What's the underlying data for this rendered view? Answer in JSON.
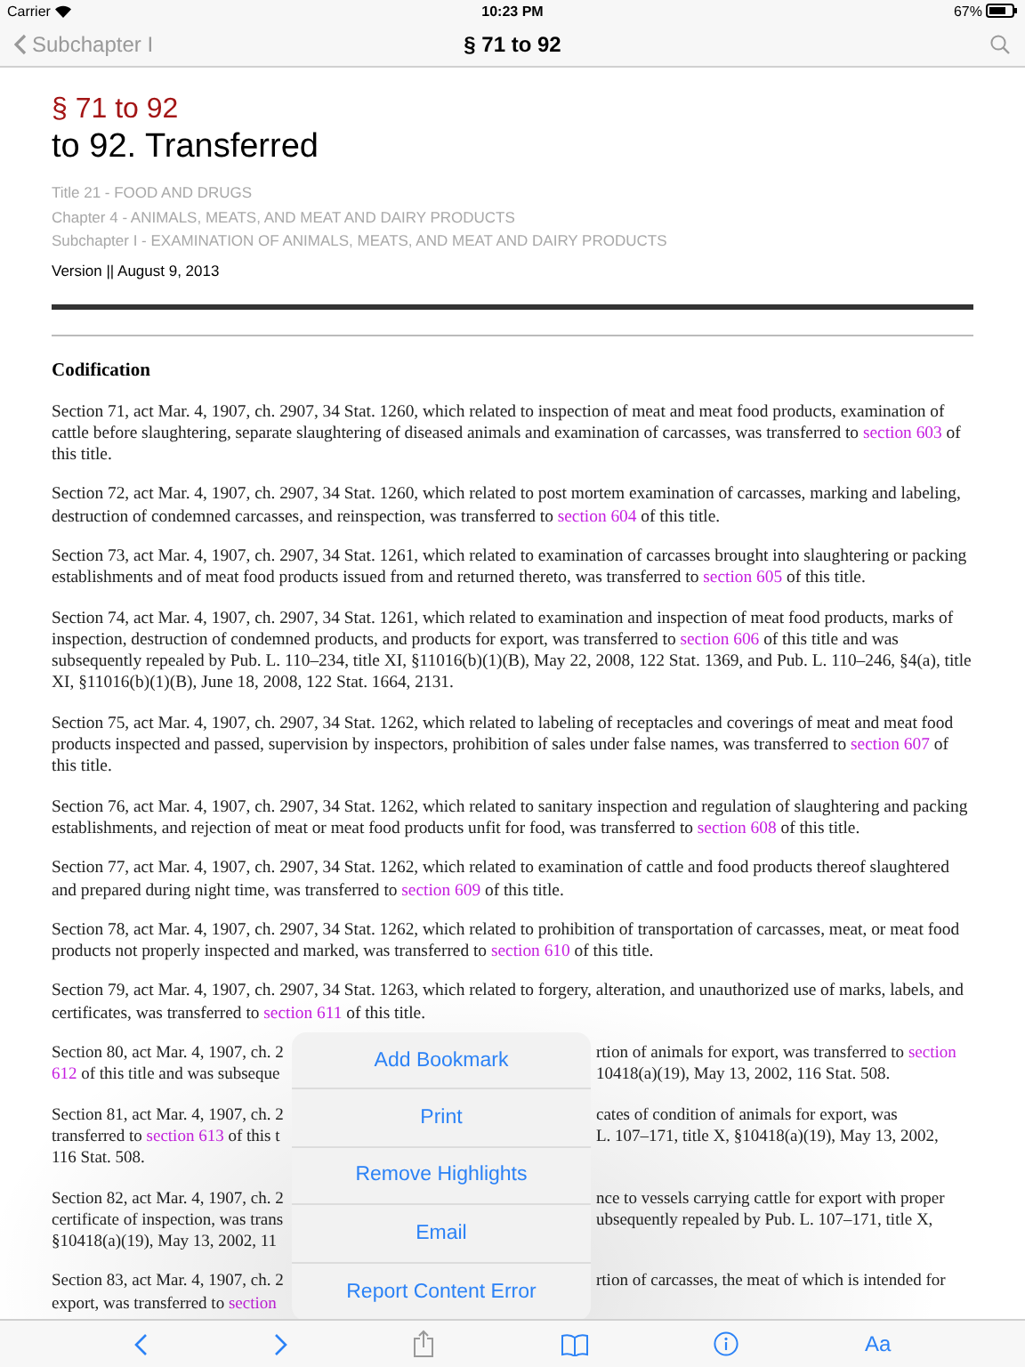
{
  "status_bar": {
    "carrier": "Carrier",
    "time": "10:23 PM",
    "battery": "67%"
  },
  "nav_bar": {
    "back": "Subchapter I",
    "title": "§ 71 to 92"
  },
  "header": {
    "section": "§ 71 to 92",
    "title": "to 92. Transferred",
    "breadcrumbs": [
      "Title 21 - FOOD AND DRUGS",
      "Chapter 4 - ANIMALS, MEATS, AND MEAT AND DAIRY PRODUCTS",
      "Subchapter I - EXAMINATION OF ANIMALS, MEATS, AND MEAT AND DAIRY PRODUCTS"
    ],
    "version": "Version || August 9, 2013"
  },
  "heading": "Codification",
  "paragraphs": [
    {
      "kind": "full",
      "segments": [
        {
          "kind": "text",
          "text": "Section 71, act Mar. 4, 1907, ch. 2907, 34 Stat. 1260, which related to inspection of meat and meat food products, examination of cattle before slaughtering, separate slaughtering of diseased animals and examination of carcasses, was transferred to "
        },
        {
          "kind": "link",
          "text": "section 603"
        },
        {
          "kind": "text",
          "text": " of this title."
        }
      ]
    },
    {
      "kind": "full",
      "segments": [
        {
          "kind": "text",
          "text": "Section 72, act Mar. 4, 1907, ch. 2907, 34 Stat. 1260, which related to post mortem examination of carcasses, marking and labeling, destruction of condemned carcasses, and reinspection, was transferred to "
        },
        {
          "kind": "link",
          "text": "section 604"
        },
        {
          "kind": "text",
          "text": " of this title."
        }
      ]
    },
    {
      "kind": "full",
      "segments": [
        {
          "kind": "text",
          "text": "Section 73, act Mar. 4, 1907, ch. 2907, 34 Stat. 1261, which related to examination of carcasses brought into slaughtering or packing establishments and of meat food products issued from and returned thereto, was transferred to "
        },
        {
          "kind": "link",
          "text": "section 605"
        },
        {
          "kind": "text",
          "text": " of this title."
        }
      ]
    },
    {
      "kind": "full",
      "segments": [
        {
          "kind": "text",
          "text": "Section 74, act Mar. 4, 1907, ch. 2907, 34 Stat. 1261, which related to examination and inspection of meat food products, marks of inspection, destruction of condemned products, and products for export, was transferred to "
        },
        {
          "kind": "link",
          "text": "section 606"
        },
        {
          "kind": "text",
          "text": " of this title and was subsequently repealed by Pub. L. 110–234, title XI, §11016(b)(1)(B), May 22, 2008, 122 Stat. 1369, and Pub. L. 110–246, §4(a), title XI, §11016(b)(1)(B), June 18, 2008, 122 Stat. 1664, 2131."
        }
      ]
    },
    {
      "kind": "full",
      "segments": [
        {
          "kind": "text",
          "text": "Section 75, act Mar. 4, 1907, ch. 2907, 34 Stat. 1262, which related to labeling of receptacles and coverings of meat and meat food products inspected and passed, supervision by inspectors, prohibition of sales under false names, was transferred to "
        },
        {
          "kind": "link",
          "text": "section 607"
        },
        {
          "kind": "text",
          "text": " of this title."
        }
      ]
    },
    {
      "kind": "full",
      "segments": [
        {
          "kind": "text",
          "text": "Section 76, act Mar. 4, 1907, ch. 2907, 34 Stat. 1262, which related to sanitary inspection and regulation of slaughtering and packing establishments, and rejection of meat or meat food products unfit for food, was transferred to "
        },
        {
          "kind": "link",
          "text": "section 608"
        },
        {
          "kind": "text",
          "text": " of this title."
        }
      ]
    },
    {
      "kind": "full",
      "segments": [
        {
          "kind": "text",
          "text": "Section 77, act Mar. 4, 1907, ch. 2907, 34 Stat. 1262, which related to examination of cattle and food products thereof slaughtered and prepared during night time, was transferred to "
        },
        {
          "kind": "link",
          "text": "section 609"
        },
        {
          "kind": "text",
          "text": " of this title."
        }
      ]
    },
    {
      "kind": "full",
      "segments": [
        {
          "kind": "text",
          "text": "Section 78, act Mar. 4, 1907, ch. 2907, 34 Stat. 1262, which related to prohibition of transportation of carcasses, meat, or meat food products not properly inspected and marked, was transferred to "
        },
        {
          "kind": "link",
          "text": "section 610"
        },
        {
          "kind": "text",
          "text": " of this title."
        }
      ]
    },
    {
      "kind": "full",
      "segments": [
        {
          "kind": "text",
          "text": "Section 79, act Mar. 4, 1907, ch. 2907, 34 Stat. 1263, which related to forgery, alteration, and unauthorized use of marks, labels, and certificates, was transferred to "
        },
        {
          "kind": "link",
          "text": "section 611"
        },
        {
          "kind": "text",
          "text": " of this title."
        }
      ]
    },
    {
      "kind": "covered",
      "lines": [
        {
          "left": [
            {
              "kind": "text",
              "text": "Section 80, act Mar. 4, 1907, ch. 2"
            }
          ],
          "right": [
            {
              "kind": "text",
              "text": "rtion of animals for export, was transferred to "
            },
            {
              "kind": "link",
              "text": "section"
            }
          ]
        },
        {
          "left": [
            {
              "kind": "link",
              "text": "612"
            },
            {
              "kind": "text",
              "text": " of this title and was subseque"
            }
          ],
          "right": [
            {
              "kind": "text",
              "text": "10418(a)(19), May 13, 2002, 116 Stat. 508."
            }
          ]
        }
      ]
    },
    {
      "kind": "covered",
      "lines": [
        {
          "left": [
            {
              "kind": "text",
              "text": "Section 81, act Mar. 4, 1907, ch. 2"
            }
          ],
          "right": [
            {
              "kind": "text",
              "text": "cates of condition of animals for export, was"
            }
          ]
        },
        {
          "left": [
            {
              "kind": "text",
              "text": "transferred to "
            },
            {
              "kind": "link",
              "text": "section 613"
            },
            {
              "kind": "text",
              "text": " of this t"
            }
          ],
          "right": [
            {
              "kind": "text",
              "text": "L. 107–171, title X, §10418(a)(19), May 13, 2002,"
            }
          ]
        },
        {
          "left": [
            {
              "kind": "text",
              "text": "116 Stat. 508."
            }
          ]
        }
      ]
    },
    {
      "kind": "covered",
      "lines": [
        {
          "left": [
            {
              "kind": "text",
              "text": "Section 82, act Mar. 4, 1907, ch. 2"
            }
          ],
          "right": [
            {
              "kind": "text",
              "text": "nce to vessels carrying cattle for export with proper"
            }
          ]
        },
        {
          "left": [
            {
              "kind": "text",
              "text": "certificate of inspection, was trans"
            }
          ],
          "right": [
            {
              "kind": "text",
              "text": "ubsequently repealed by Pub. L. 107–171, title X,"
            }
          ]
        },
        {
          "left": [
            {
              "kind": "text",
              "text": "§10418(a)(19), May 13, 2002, 11"
            }
          ]
        }
      ]
    },
    {
      "kind": "covered",
      "lines": [
        {
          "left": [
            {
              "kind": "text",
              "text": "Section 83, act Mar. 4, 1907, ch. 2"
            }
          ],
          "right": [
            {
              "kind": "text",
              "text": "rtion of carcasses, the meat of which is intended for"
            }
          ]
        },
        {
          "left": [
            {
              "kind": "text",
              "text": "export, was transferred to "
            },
            {
              "kind": "link",
              "text": "section"
            }
          ]
        }
      ]
    }
  ],
  "popover": {
    "items": [
      "Add Bookmark",
      "Print",
      "Remove Highlights",
      "Email",
      "Report Content Error"
    ]
  },
  "toolbar": {
    "font_button": "Aa"
  }
}
